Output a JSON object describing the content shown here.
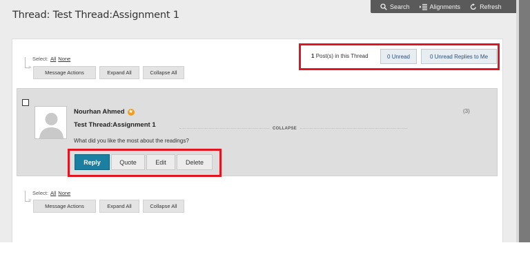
{
  "toolbar": {
    "search": "Search",
    "alignments": "Alignments",
    "refresh": "Refresh"
  },
  "page_title": "Thread: Test Thread:Assignment 1",
  "select": {
    "label": "Select:",
    "all": "All",
    "none": "None"
  },
  "actions": {
    "message_actions": "Message Actions",
    "expand_all": "Expand All",
    "collapse_all": "Collapse All"
  },
  "thread_stats": {
    "post_count": "1",
    "post_count_label": "Post(s) in this Thread",
    "unread": "0 Unread",
    "unread_replies": "0 Unread Replies to Me"
  },
  "post": {
    "author": "Nourhan Ahmed",
    "badge": "★",
    "count": "(3)",
    "subject": "Test Thread:Assignment 1",
    "collapse": "COLLAPSE",
    "body": "What did you like the most about the readings?",
    "buttons": {
      "reply": "Reply",
      "quote": "Quote",
      "edit": "Edit",
      "delete": "Delete"
    }
  },
  "colors": {
    "highlight": "#e1141f",
    "reply_button": "#1a7fa0",
    "topbar": "#5a5a5a",
    "badge": "#f29c1f"
  }
}
